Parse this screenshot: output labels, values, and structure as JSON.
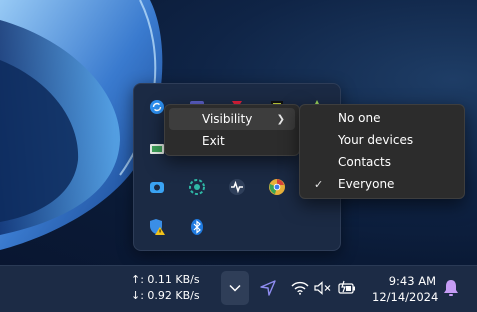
{
  "context_menu": {
    "items": [
      {
        "label": "Visibility",
        "has_submenu": true
      },
      {
        "label": "Exit"
      }
    ]
  },
  "visibility_submenu": {
    "items": [
      {
        "label": "No one",
        "checked": false
      },
      {
        "label": "Your devices",
        "checked": false
      },
      {
        "label": "Contacts",
        "checked": false
      },
      {
        "label": "Everyone",
        "checked": true
      }
    ],
    "check_glyph": "✓"
  },
  "tray_icons": [
    "sync-icon",
    "teams-icon",
    "red-app-icon",
    "dark-app-icon",
    "green-app-icon",
    "display-icon",
    "camera-icon",
    "circle-app-icon",
    "waveform-icon",
    "chrome-icon",
    "security-warning-icon",
    "bluetooth-icon"
  ],
  "taskbar": {
    "upload_speed": "↑: 0.11 KB/s",
    "download_speed": "↓: 0.92 KB/s",
    "time": "9:43 AM",
    "date": "12/14/2024"
  },
  "colors": {
    "accent": "#8e8cf0",
    "menu_bg": "#2c2c2c",
    "taskbar_bg": "#1c2b45",
    "bell": "#c59cf5"
  }
}
